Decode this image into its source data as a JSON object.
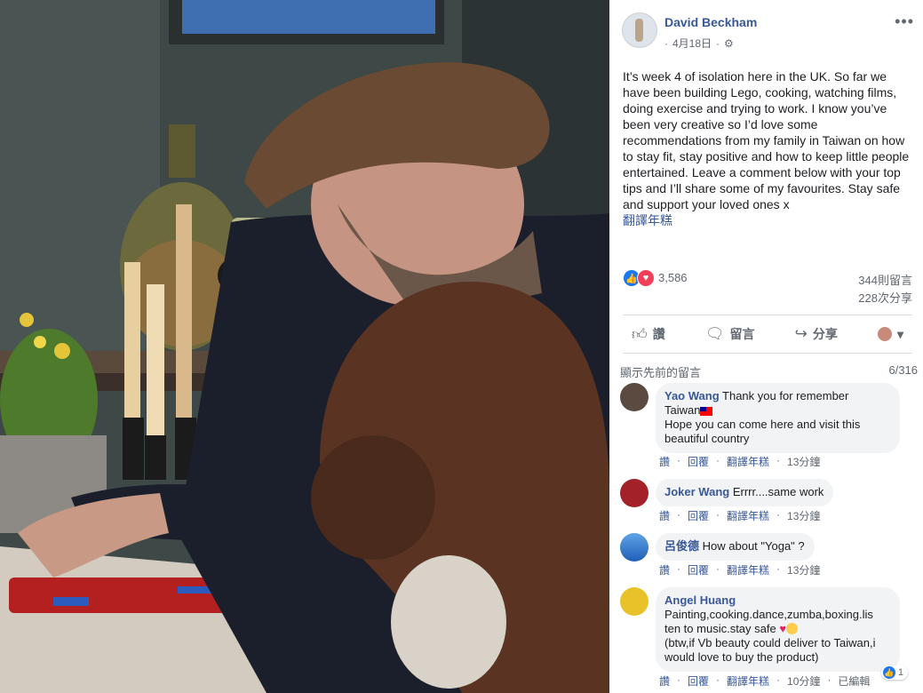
{
  "post": {
    "author": "David Beckham",
    "date": "4月18日",
    "audience_icon": "gear-icon",
    "text": "It’s week 4 of isolation here in the UK. So far we have been building Lego, cooking, watching films, doing exercise and trying to work. I know you’ve been very creative so I’d love some recommendations from my family in Taiwan on how to stay fit, stay positive and how to keep little people entertained. Leave a comment below with your top tips and I’ll share some of my favourites. Stay safe and support your loved ones x",
    "translate_label": "翻譯年糕",
    "more_icon": "more-icon"
  },
  "stats": {
    "reactions": "3,586",
    "comments": "344則留言",
    "shares": "228次分享"
  },
  "actions": {
    "like": "讚",
    "comment": "留言",
    "share": "分享"
  },
  "comments_section": {
    "sort_label": "顯示先前的留言",
    "count_label": "6/316"
  },
  "comments": [
    {
      "name": "Yao Wang",
      "line1": "Thank you for remember",
      "line2": "Taiwan",
      "line3": "Hope you can come here and visit this",
      "line4": "beautiful country",
      "like": "讚",
      "reply": "回覆",
      "translate": "翻譯年糕",
      "time": "13分鐘"
    },
    {
      "name": "Joker Wang",
      "text": "Errrr....same work",
      "like": "讚",
      "reply": "回覆",
      "translate": "翻譯年糕",
      "time": "13分鐘"
    },
    {
      "name": "呂俊德",
      "text": "How about \"Yoga\" ?",
      "like": "讚",
      "reply": "回覆",
      "translate": "翻譯年糕",
      "time": "13分鐘"
    },
    {
      "name": "Angel Huang",
      "line1": "Painting,cooking.dance,zumba,boxing.lis",
      "line2": "ten to music.stay safe",
      "line3": "(btw,if Vb beauty could deliver to Taiwan,i",
      "line4": "would love to buy the product)",
      "reactions": "1",
      "like": "讚",
      "reply": "回覆",
      "translate": "翻譯年糕",
      "time": "10分鐘",
      "edited": "已編輯"
    }
  ]
}
